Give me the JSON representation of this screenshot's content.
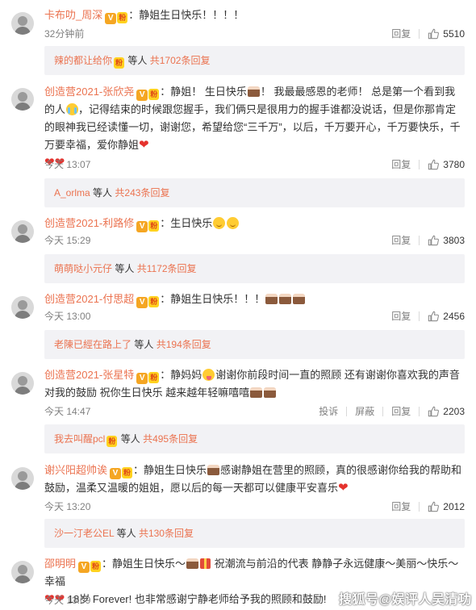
{
  "colors": {
    "username": "#eb7350",
    "secondary": "#808080",
    "reply_bar_bg": "#f2f2f5",
    "heart": "#e5322d"
  },
  "icons": {
    "verified": "v-badge-icon",
    "fan_level": "fan-badge-icon",
    "like": "thumb-up-icon",
    "cake": "cake-emoji",
    "heart": "heart-emoji",
    "smile": "smile-emoji",
    "cry": "cry-emoji",
    "tongue": "tongue-emoji",
    "gift": "gift-emoji"
  },
  "labels": {
    "reply": "回复",
    "report": "投诉",
    "block": "屏蔽",
    "reply_suffix_pre": "等人",
    "reply_suffix_count_pre": "共",
    "reply_suffix_count_post": "条回复"
  },
  "comments": [
    {
      "user": "卡布叻_周深",
      "text": "：静姐生日快乐！！！！",
      "time": "32分钟前",
      "likes": "5510",
      "reply_user": "辣的都让给你",
      "reply_total": "1702"
    },
    {
      "user": "创造营2021-张欣尧",
      "text_a": "：静姐！ 生日快乐",
      "text_b": "！ 我最最感恩的老师！ 总是第一个看到我的人",
      "text_c": "，记得结束的时候跟您握手，我们俩只是很用力的握手谁都没说话，但是你那肯定的眼神我已经读懂一切，谢谢您，希望给您“三千万”，以后，千万要开心，千万要快乐，千万要幸福，爱你静姐",
      "time": "今天 13:07",
      "likes": "3780",
      "reply_user": "A_orlma",
      "reply_total": "243"
    },
    {
      "user": "创造营2021-利路修",
      "text": "：生日快乐",
      "time": "今天 15:29",
      "likes": "3803",
      "reply_user": "萌萌哒小元仔",
      "reply_total": "1172"
    },
    {
      "user": "创造营2021-付思超",
      "text": "：静姐生日快乐！！！",
      "time": "今天 13:00",
      "likes": "2456",
      "reply_user": "老陳已經在路上了",
      "reply_total": "194"
    },
    {
      "user": "创造营2021-张星特",
      "text_a": "：静妈妈",
      "text_b": "谢谢你前段时间一直的照顾 还有谢谢你喜欢我的声音对我的鼓励 祝你生日快乐 越来越年轻嘛嘻嘻",
      "time": "今天 14:47",
      "likes": "2203",
      "reply_user": "我去叫醒pcl",
      "reply_total": "495"
    },
    {
      "user": "谢兴阳超帅诶",
      "text_a": "：静姐生日快乐",
      "text_b": "感谢静姐在营里的照顾，真的很感谢你给我的帮助和鼓励，温柔又温暖的姐姐，愿以后的每一天都可以健康平安喜乐",
      "time": "今天 13:20",
      "likes": "2012",
      "reply_user": "沙一汀老公EL",
      "reply_total": "130"
    },
    {
      "user": "邵明明",
      "text_a": "：静姐生日快乐～",
      "text_b": "祝潮流与前沿的代表 静静子永远健康～美丽～快乐～幸福",
      "text_c": "18岁 Forever! 也非常感谢宁静老师给予我的照顾和鼓励!",
      "time": "今天 13:09"
    }
  ],
  "watermark": "搜狐号@娱评人吴清功"
}
